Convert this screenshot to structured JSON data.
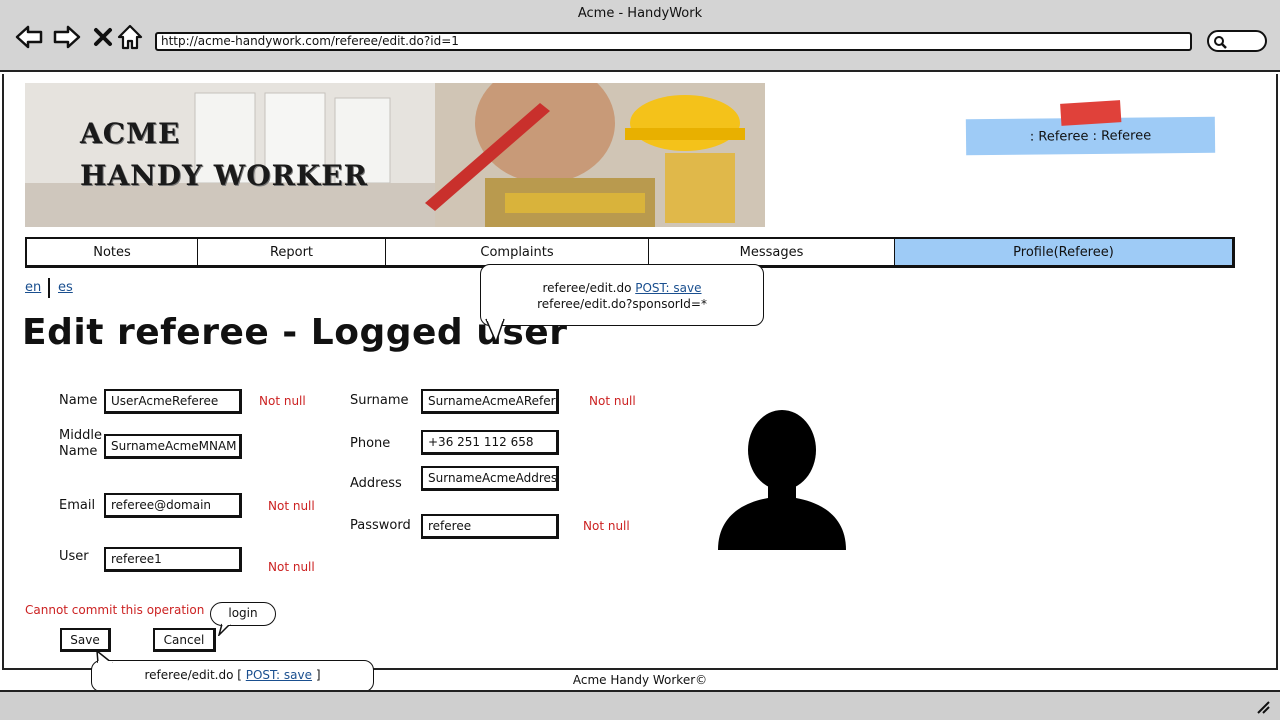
{
  "window": {
    "title": "Acme - HandyWork",
    "url": "http://acme-handywork.com/referee/edit.do?id=1"
  },
  "banner": {
    "line1": "ACME",
    "line2": "HANDY WORKER"
  },
  "user_tag": ": Referee : Referee",
  "menu": [
    {
      "label": "Notes",
      "active": false
    },
    {
      "label": "Report",
      "active": false
    },
    {
      "label": "Complaints",
      "active": false
    },
    {
      "label": "Messages",
      "active": false
    },
    {
      "label": "Profile(Referee)",
      "active": true
    }
  ],
  "lang": {
    "en": "en",
    "es": "es"
  },
  "page_title": "Edit referee - Logged user",
  "callout_top": {
    "prefix": "referee/edit.do ",
    "link": "POST: save",
    "line2": "referee/edit.do?sponsorId=*"
  },
  "form": {
    "name": {
      "label": "Name",
      "value": "UserAcmeReferee",
      "error": "Not null"
    },
    "middle_name": {
      "label1": "Middle",
      "label2": "Name",
      "value": "SurnameAcmeMNAM"
    },
    "email": {
      "label": "Email",
      "value": "referee@domain",
      "error": "Not null"
    },
    "user": {
      "label": "User",
      "value": "referee1",
      "error": "Not null"
    },
    "surname": {
      "label": "Surname",
      "value": "SurnameAcmeARefer",
      "error": "Not null"
    },
    "phone": {
      "label": "Phone",
      "value": "+36 251 112 658"
    },
    "address": {
      "label": "Address",
      "value": "SurnameAcmeAddress"
    },
    "password": {
      "label": "Password",
      "value": "referee",
      "error": "Not null"
    }
  },
  "commit_error": "Cannot commit this operation",
  "buttons": {
    "save": "Save",
    "cancel": "Cancel"
  },
  "bubble_login": "login",
  "callout_bottom": {
    "prefix": "referee/edit.do [ ",
    "link": "POST: save",
    "suffix": " ]"
  },
  "footer": "Acme Handy Worker©",
  "colors": {
    "accent": "#9ecbf6",
    "error": "#cc2222",
    "link": "#1a4f8f"
  }
}
